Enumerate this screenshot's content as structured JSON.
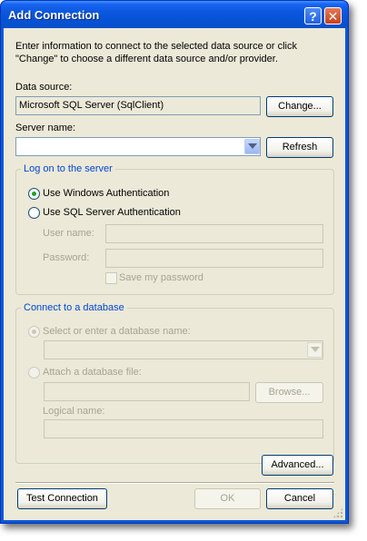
{
  "window": {
    "title": "Add Connection",
    "help_glyph": "?",
    "close_glyph": "✕"
  },
  "intro_text": "Enter information to connect to the selected data source or click \"Change\" to choose a different data source and/or provider.",
  "data_source": {
    "label": "Data source:",
    "value": "Microsoft SQL Server (SqlClient)",
    "change_button": "Change..."
  },
  "server": {
    "label": "Server name:",
    "value": "",
    "refresh_button": "Refresh"
  },
  "logon_group": {
    "legend": "Log on to the server",
    "windows_auth": "Use Windows Authentication",
    "sql_auth": "Use SQL Server Authentication",
    "selected": "windows",
    "user_label": "User name:",
    "user_value": "",
    "password_label": "Password:",
    "password_value": "",
    "save_password": "Save my password"
  },
  "database_group": {
    "legend": "Connect to a database",
    "select_option": "Select or enter a database name:",
    "select_value": "",
    "attach_option": "Attach a database file:",
    "attach_value": "",
    "browse_button": "Browse...",
    "logical_label": "Logical name:",
    "logical_value": ""
  },
  "buttons": {
    "advanced": "Advanced...",
    "test": "Test Connection",
    "ok": "OK",
    "cancel": "Cancel"
  }
}
